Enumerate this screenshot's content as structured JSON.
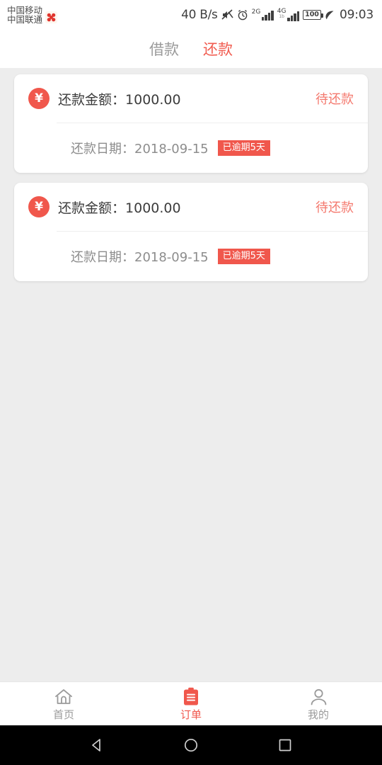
{
  "status_bar": {
    "carrier_line1": "中国移动",
    "carrier_line2": "中国联通",
    "carrier_icon": "red-flower-badge-icon",
    "network_speed": "40 B/s",
    "mute_icon": "mute-icon",
    "alarm_icon": "alarm-clock-icon",
    "signal1_label": "2G",
    "signal2_label": "4G",
    "signal2_sublabel": "1b",
    "battery_level": "100",
    "charging_icon": "leaf-icon",
    "time": "09:03"
  },
  "header": {
    "tabs": [
      {
        "label": "借款",
        "active": false
      },
      {
        "label": "还款",
        "active": true
      }
    ]
  },
  "cards": [
    {
      "icon": "yen-icon",
      "icon_symbol": "¥",
      "amount_label": "还款金额：",
      "amount_value": "1000.00",
      "status": "待还款",
      "date_label": "还款日期：",
      "date_value": "2018-09-15",
      "overdue_badge": "已逾期5天"
    },
    {
      "icon": "yen-icon",
      "icon_symbol": "¥",
      "amount_label": "还款金额：",
      "amount_value": "1000.00",
      "status": "待还款",
      "date_label": "还款日期：",
      "date_value": "2018-09-15",
      "overdue_badge": "已逾期5天"
    }
  ],
  "bottom_nav": [
    {
      "label": "首页",
      "icon": "home-icon",
      "active": false
    },
    {
      "label": "订单",
      "icon": "clipboard-icon",
      "active": true
    },
    {
      "label": "我的",
      "icon": "person-icon",
      "active": false
    }
  ],
  "android_nav": {
    "back": "back-triangle-icon",
    "home": "home-circle-icon",
    "recents": "recents-square-icon"
  },
  "colors": {
    "accent_red": "#f0574c",
    "status_red": "#f4796e",
    "tab_active": "#f15c50",
    "background": "#ededed",
    "card": "#ffffff",
    "text_dark": "#3c3c3c",
    "text_gray": "#8d8d8d"
  }
}
